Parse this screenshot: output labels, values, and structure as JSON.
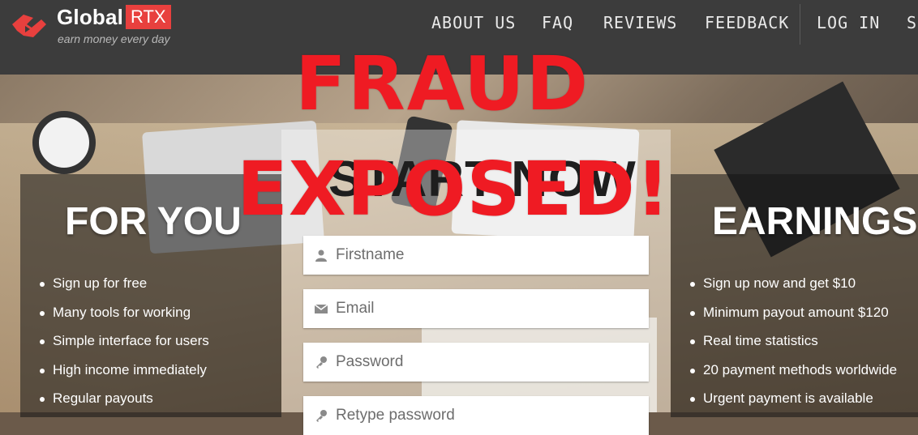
{
  "header": {
    "brand_name": "Global",
    "brand_badge": "RTX",
    "tagline": "earn money every day",
    "nav": [
      "ABOUT US",
      "FAQ",
      "REVIEWS",
      "FEEDBACK",
      "LOG IN",
      "S"
    ]
  },
  "overlay": {
    "line1": "FRAUD",
    "line2": "EXPOSED!"
  },
  "left_panel": {
    "title": "FOR YOU",
    "items": [
      "Sign up for free",
      "Many tools for working",
      "Simple interface for users",
      "High income immediately",
      "Regular payouts"
    ]
  },
  "center_panel": {
    "title": "START NOW",
    "fields": [
      {
        "icon": "user-icon",
        "placeholder": "Firstname"
      },
      {
        "icon": "envelope-icon",
        "placeholder": "Email"
      },
      {
        "icon": "key-icon",
        "placeholder": "Password"
      },
      {
        "icon": "key-icon",
        "placeholder": "Retype password"
      }
    ]
  },
  "right_panel": {
    "title": "EARNINGS",
    "items": [
      "Sign up now and get $10",
      "Minimum payout amount $120",
      "Real time statistics",
      "20 payment methods worldwide",
      "Urgent payment is available"
    ]
  },
  "colors": {
    "header_bg": "#3c3c3c",
    "brand_red": "#e8403e",
    "overlay_red": "#ef1b23"
  }
}
